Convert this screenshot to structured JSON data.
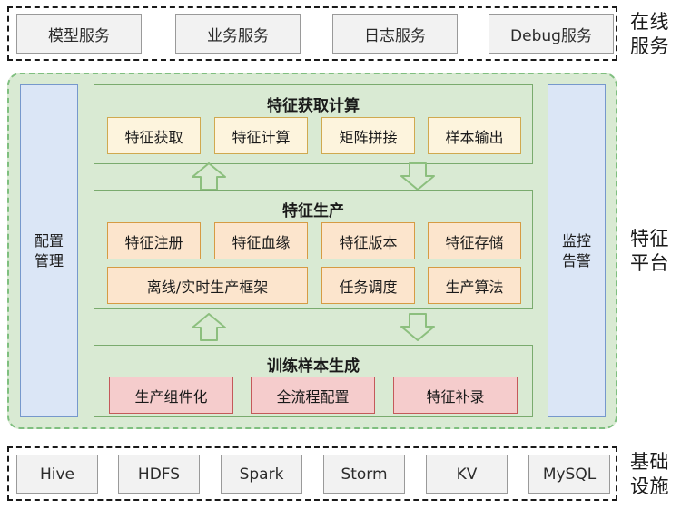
{
  "layers": {
    "online": {
      "caption": "在线\n服务",
      "items": [
        {
          "label": "模型服务"
        },
        {
          "label": "业务服务"
        },
        {
          "label": "日志服务"
        },
        {
          "label": "Debug服务"
        }
      ]
    },
    "platform": {
      "caption": "特征\n平台",
      "left_pillar": "配置\n管理",
      "right_pillar": "监控\n告警",
      "groups": [
        {
          "title": "特征获取计算",
          "style": "cream",
          "rows": [
            [
              "特征获取",
              "特征计算",
              "矩阵拼接",
              "样本输出"
            ]
          ]
        },
        {
          "title": "特征生产",
          "style": "peach",
          "rows": [
            [
              "特征注册",
              "特征血缘",
              "特征版本",
              "特征存储"
            ],
            [
              "离线/实时生产框架",
              "任务调度",
              "生产算法"
            ]
          ]
        },
        {
          "title": "训练样本生成",
          "style": "pink",
          "rows": [
            [
              "生产组件化",
              "全流程配置",
              "特征补录"
            ]
          ]
        }
      ],
      "arrows": [
        {
          "direction": "up",
          "between": "特征生产 → 特征获取计算"
        },
        {
          "direction": "down",
          "between": "特征获取计算 → 特征生产"
        },
        {
          "direction": "up",
          "between": "训练样本生成 → 特征生产"
        },
        {
          "direction": "down",
          "between": "特征生产 → 训练样本生成"
        }
      ]
    },
    "infrastructure": {
      "caption": "基础\n设施",
      "items": [
        {
          "label": "Hive"
        },
        {
          "label": "HDFS"
        },
        {
          "label": "Spark"
        },
        {
          "label": "Storm"
        },
        {
          "label": "KV"
        },
        {
          "label": "MySQL"
        }
      ]
    }
  },
  "colors": {
    "platform_fill": "#d9ead3",
    "platform_border": "#7fbf7f",
    "pillar_fill": "#dbe6f6",
    "pillar_border": "#7698cc",
    "cream_fill": "#fdf4dd",
    "cream_border": "#d0a94f",
    "peach_fill": "#fce5cd",
    "peach_border": "#d69b43",
    "pink_fill": "#f5cccc",
    "pink_border": "#c4595a",
    "chip_fill": "#f2f2f2",
    "chip_border": "#9a9a9a",
    "text": "#1a1a1a"
  }
}
